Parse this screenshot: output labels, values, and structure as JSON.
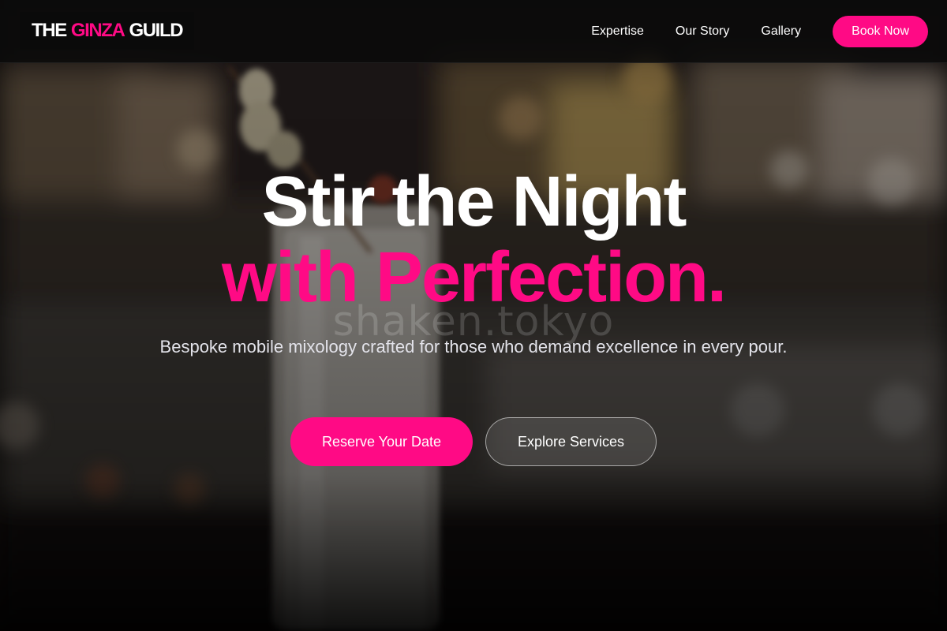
{
  "brand": {
    "part1": "THE",
    "part2": "GINZA",
    "part3": "GUILD",
    "accent_color": "#ff0a85"
  },
  "nav": {
    "links": [
      {
        "label": "Expertise"
      },
      {
        "label": "Our Story"
      },
      {
        "label": "Gallery"
      }
    ],
    "book_label": "Book Now"
  },
  "hero": {
    "title_line1": "Stir the Night",
    "title_line2": "with Perfection.",
    "subtitle": "Bespoke mobile mixology crafted for those who demand excellence in every pour.",
    "primary_cta": "Reserve Your Date",
    "secondary_cta": "Explore Services",
    "background_image": "blurred bar with cocktail glass",
    "watermark": "shaken.tokyo"
  }
}
